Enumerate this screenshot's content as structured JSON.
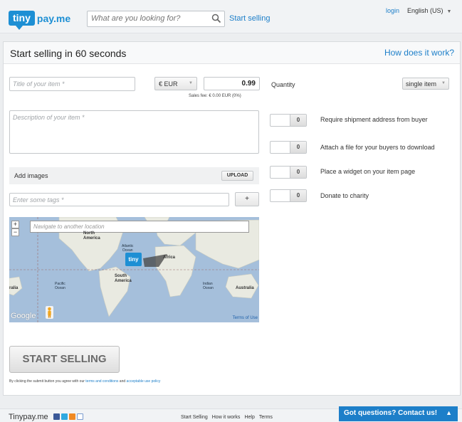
{
  "header": {
    "logo_tiny": "tiny",
    "logo_pay": "pay.me",
    "search_placeholder": "What are you looking for?",
    "start_selling": "Start selling",
    "login": "login",
    "language": "English (US)"
  },
  "panel": {
    "title": "Start selling in 60 seconds",
    "how_it_works": "How does it work?"
  },
  "form": {
    "title_placeholder": "Title of your item *",
    "currency": "€  EUR",
    "price": "0.99",
    "quantity_label": "Quantity",
    "quantity_value": "single item",
    "sales_fee": "Sales fee: € 0.00 EUR (0%)",
    "description_placeholder": "Description of your item *",
    "add_images": "Add images",
    "upload": "UPLOAD",
    "tags_placeholder": "Enter some tags *",
    "add_tag": "+",
    "map_search_placeholder": "Navigate to another location",
    "submit": "START SELLING",
    "terms_prefix": "By clicking the submit button you agree with our ",
    "terms_link": "terms and conditions",
    "terms_mid": " and ",
    "aup_link": "acceptable use policy"
  },
  "options": [
    {
      "label": "Require shipment address from buyer",
      "value": "0"
    },
    {
      "label": "Attach a file for your buyers to download",
      "value": "0"
    },
    {
      "label": "Place a widget on your item page",
      "value": "0"
    },
    {
      "label": "Donate to charity",
      "value": "0"
    }
  ],
  "map": {
    "labels": {
      "north_america": "North\nAmerica",
      "atlantic": "Atlantic\nOcean",
      "africa": "Africa",
      "south_america": "South\nAmerica",
      "pacific": "Pacific\nOcean",
      "indian": "Indian\nOcean",
      "australia": "Australia",
      "australia_left": "ralia",
      "pin": "tiny"
    },
    "google": "Google",
    "terms": "Terms of Use",
    "zoom_in": "+",
    "zoom_out": "−"
  },
  "footer": {
    "brand": "Tinypay.me",
    "links": [
      "Start Selling",
      "How it works",
      "Help",
      "Terms"
    ],
    "contact": "Got questions? Contact us!"
  },
  "colors": {
    "accent": "#1d7fc9",
    "logo_blue": "#1d8fd4",
    "map_water": "#a5bfdb",
    "map_land": "#e9eae1"
  }
}
